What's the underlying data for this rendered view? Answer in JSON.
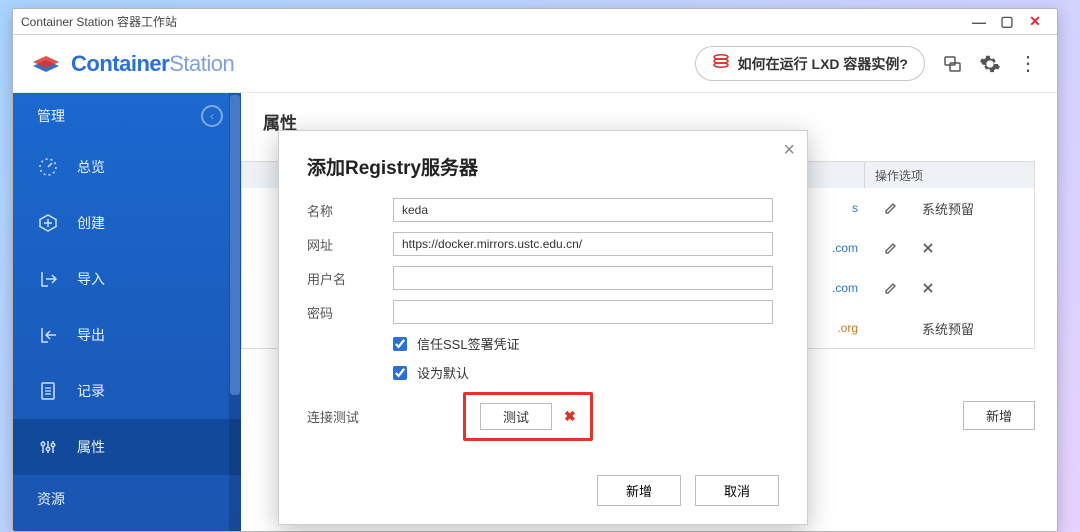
{
  "window": {
    "title": "Container Station 容器工作站"
  },
  "logo": {
    "main": "Container",
    "sub": "Station"
  },
  "header": {
    "help_label": "如何在运行 LXD 容器实例?",
    "icons": {
      "net": "network-icon",
      "gear": "gear-icon",
      "more": "more-icon"
    }
  },
  "sidebar": {
    "header": "管理",
    "items": [
      {
        "label": "总览",
        "icon": "gauge-icon"
      },
      {
        "label": "创建",
        "icon": "plus-circle-icon"
      },
      {
        "label": "导入",
        "icon": "import-icon"
      },
      {
        "label": "导出",
        "icon": "export-icon"
      },
      {
        "label": "记录",
        "icon": "doc-icon"
      },
      {
        "label": "属性",
        "icon": "sliders-icon"
      }
    ],
    "footer": "资源"
  },
  "page": {
    "title": "属性",
    "table": {
      "header_ops": "操作选项",
      "rows": [
        {
          "url_suffix": "s",
          "reserved": "系统预留"
        },
        {
          "url_suffix": ".com",
          "reserved": ""
        },
        {
          "url_suffix": ".com",
          "reserved": ""
        },
        {
          "url_suffix": ".org",
          "reserved": "系统预留"
        }
      ]
    },
    "add_button": "新增"
  },
  "modal": {
    "title": "添加Registry服务器",
    "labels": {
      "name": "名称",
      "url": "网址",
      "user": "用户名",
      "password": "密码",
      "trust_ssl": "信任SSL签署凭证",
      "set_default": "设为默认",
      "conn_test": "连接测试"
    },
    "values": {
      "name": "keda",
      "url": "https://docker.mirrors.ustc.edu.cn/",
      "user": "",
      "password": "",
      "trust_ssl": true,
      "set_default": true
    },
    "test_button": "测试",
    "buttons": {
      "add": "新增",
      "cancel": "取消"
    }
  }
}
